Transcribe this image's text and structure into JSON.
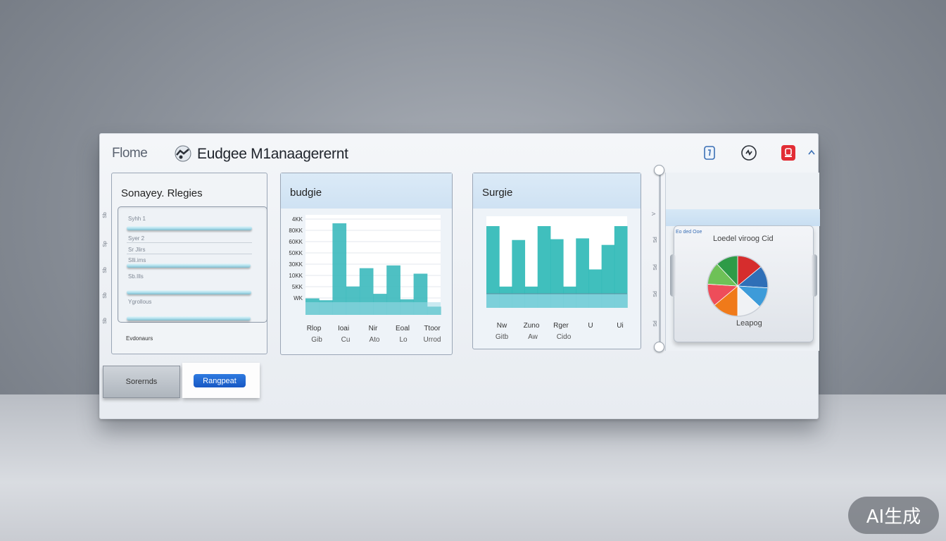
{
  "topbar": {
    "home_label": "Flome",
    "app_title": "Eudgee M1anaagerernt",
    "icons": [
      "document-icon",
      "settings-icon",
      "notification-icon",
      "chevron-up-icon"
    ],
    "accent_red": "#e22d35"
  },
  "panel_list": {
    "title": "Sonayey. Rlegies",
    "rows": [
      "Syhh 1",
      "Syer 2",
      "Sr Jlirs",
      "Slli.ims",
      "Sb.Ills",
      "Ygrollous"
    ],
    "footer": "Evdonaurs",
    "side_labels": [
      "Sb",
      "Sp",
      "Sb",
      "Sb",
      "Sb"
    ]
  },
  "panel_budget": {
    "title": "budgie",
    "chart_data": {
      "type": "bar",
      "y_ticks": [
        "4KK",
        "80KK",
        "60KK",
        "50KK",
        "30KK",
        "10KK",
        "5KK",
        "WK"
      ],
      "x_labels": [
        "Rlop",
        "Ioai",
        "Nir",
        "Eoal",
        "Ttoor"
      ],
      "x_labels_row2": [
        "Gib",
        "Cu",
        "Ato",
        "Lo",
        "Urrod"
      ],
      "values": [
        18,
        16,
        100,
        31,
        51,
        23,
        54,
        17,
        45,
        9
      ],
      "bar_color": "#3bb9bd"
    }
  },
  "panel_surge": {
    "title": "Surgie",
    "chart_data": {
      "type": "bar",
      "x_labels": [
        "Nw",
        "Zuno",
        "Rger",
        "U",
        "Ui"
      ],
      "x_labels_row2": [
        "Gitb",
        "Aw",
        "Cido"
      ],
      "values": [
        100,
        26,
        83,
        26,
        100,
        84,
        26,
        85,
        47,
        77,
        100
      ],
      "bar_color": "#2bb8b6"
    }
  },
  "panel_pie": {
    "header": "Eo ded Ooe",
    "title": "Loedel viroog Cid",
    "caption": "Leapog",
    "side_labels": [
      "V",
      "Sd",
      "Sd",
      "Sd",
      "Sd"
    ],
    "chart_data": {
      "type": "pie",
      "values": [
        14,
        12,
        11,
        13,
        14,
        12,
        12,
        12
      ],
      "colors": [
        "#d62d2d",
        "#2f6fb7",
        "#3d9bd9",
        "#f0f2f5",
        "#f07a1a",
        "#ee4d5a",
        "#6ec157",
        "#2e9b47"
      ]
    }
  },
  "buttons": {
    "secondary_label": "Sorernds",
    "primary_label": "Rangpeat"
  },
  "watermark": "AI生成"
}
